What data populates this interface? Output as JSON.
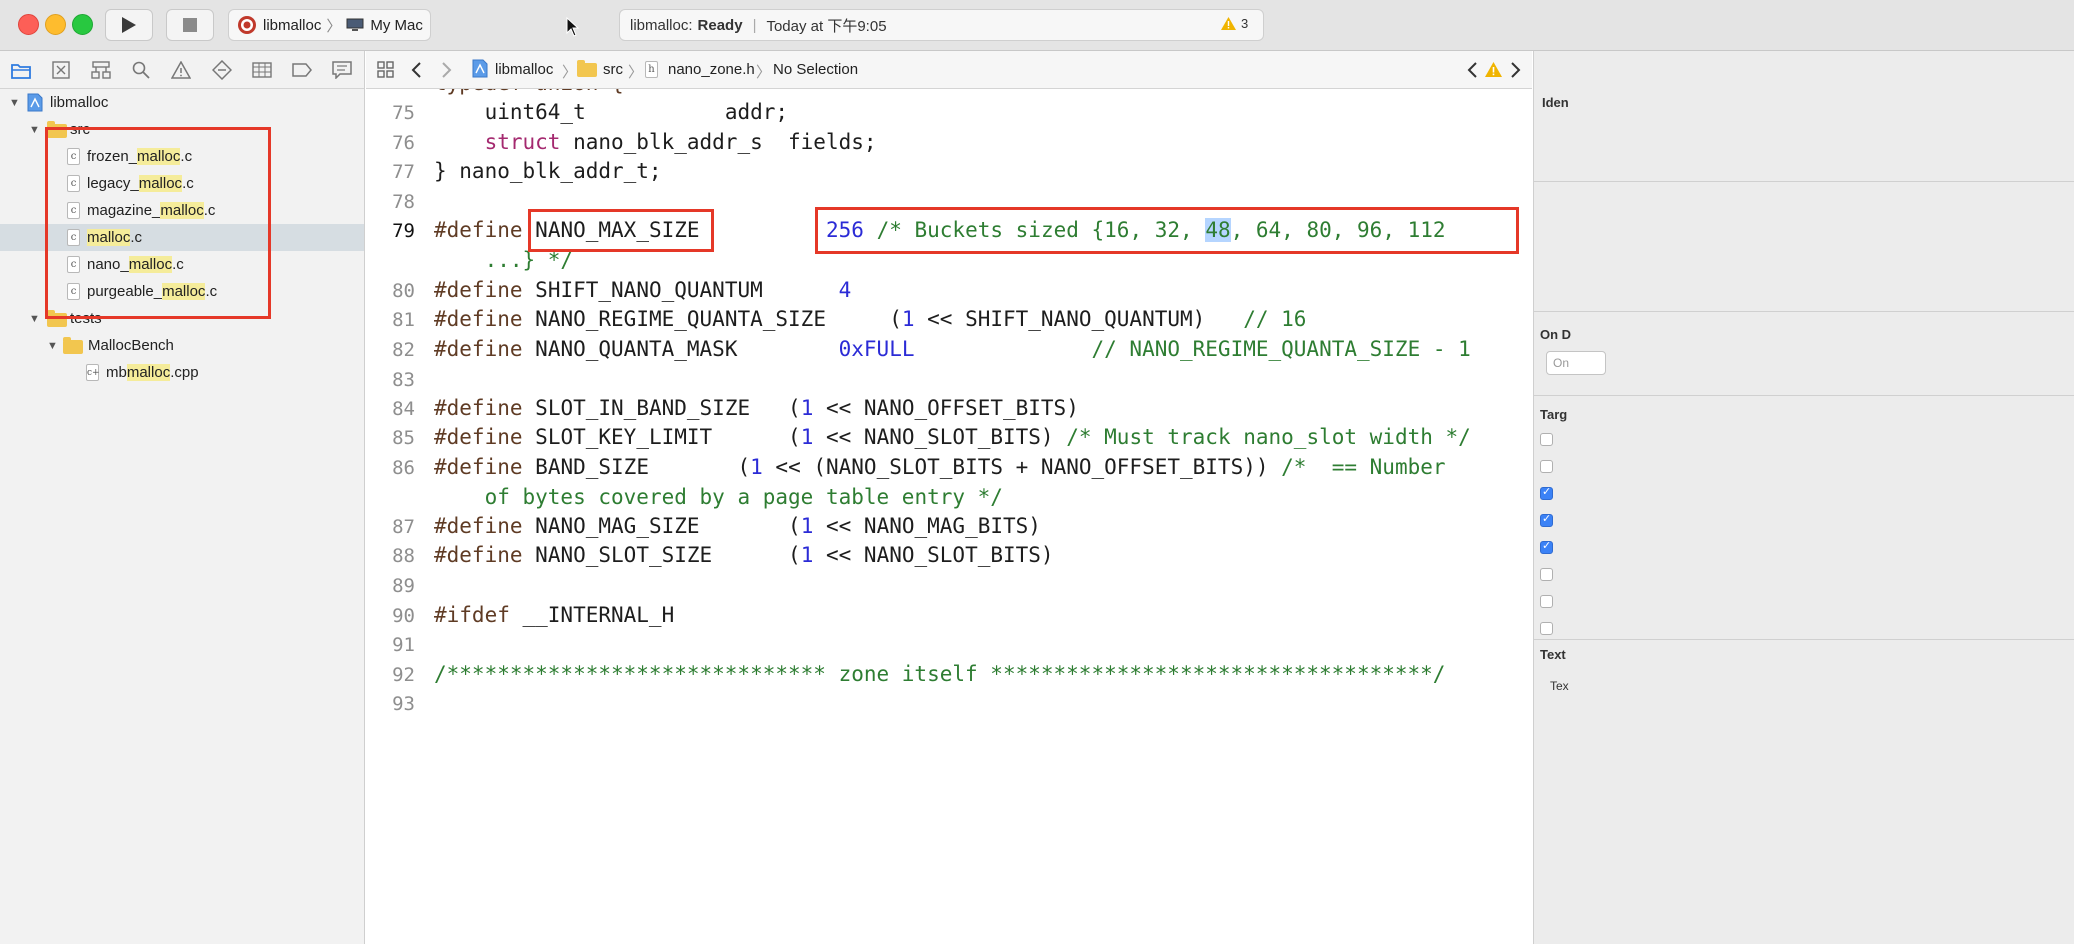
{
  "toolbar": {
    "run_icon": "play-icon",
    "stop_icon": "stop-icon",
    "scheme_name": "libmalloc",
    "destination": "My Mac",
    "status_project": "libmalloc:",
    "status_state": "Ready",
    "status_time": "Today at 下午9:05",
    "warning_count": "3"
  },
  "navigator": {
    "tabs": [
      "folder-icon",
      "source-control-icon",
      "symbol-icon",
      "find-icon",
      "issue-icon",
      "test-icon",
      "debug-icon",
      "breakpoint-icon",
      "report-icon"
    ],
    "project": "libmalloc",
    "group_src": "src",
    "files_src": [
      {
        "prefix": "frozen_",
        "match": "malloc",
        "suffix": ".c"
      },
      {
        "prefix": "legacy_",
        "match": "malloc",
        "suffix": ".c"
      },
      {
        "prefix": "magazine_",
        "match": "malloc",
        "suffix": ".c"
      },
      {
        "prefix": "",
        "match": "malloc",
        "suffix": ".c"
      },
      {
        "prefix": "nano_",
        "match": "malloc",
        "suffix": ".c"
      },
      {
        "prefix": "purgeable_",
        "match": "malloc",
        "suffix": ".c"
      }
    ],
    "group_tests": "tests",
    "group_bench": "MallocBench",
    "bench_file": {
      "prefix": "mb",
      "match": "malloc",
      "suffix": ".cpp"
    }
  },
  "jumpbar": {
    "project": "libmalloc",
    "folder": "src",
    "file": "nano_zone.h",
    "symbol": "No Selection"
  },
  "editor": {
    "line_numbers": [
      "75",
      "76",
      "77",
      "78",
      "79",
      "80",
      "81",
      "82",
      "83",
      "84",
      "85",
      "86",
      "87",
      "88",
      "89",
      "90",
      "91",
      "92",
      "93"
    ],
    "line75_type": "uint64_t",
    "line75_field": "addr;",
    "line76_kw": "struct",
    "line76_rest": " nano_blk_addr_s  fields;",
    "line77": "} nano_blk_addr_t;",
    "define_kw": "#define",
    "line79_name": "NANO_MAX_SIZE",
    "line79_value": "256",
    "line79_comment_a": "/* Buckets sized {16, 32, ",
    "line79_comment_sel": "48",
    "line79_comment_b": ", 64, 80, 96, 112",
    "line79_cont": "...} */",
    "line80_name": "SHIFT_NANO_QUANTUM",
    "line80_value": "4",
    "line81_name": "NANO_REGIME_QUANTA_SIZE",
    "line81_open": "(",
    "line81_num": "1",
    "line81_rest": " << SHIFT_NANO_QUANTUM)",
    "line81_comment": "// 16",
    "line82_name": "NANO_QUANTA_MASK",
    "line82_value": "0xFULL",
    "line82_comment": "// NANO_REGIME_QUANTA_SIZE - 1",
    "line84_name": "SLOT_IN_BAND_SIZE",
    "line84_num": "1",
    "line84_rest": " << NANO_OFFSET_BITS)",
    "line85_name": "SLOT_KEY_LIMIT",
    "line85_num": "1",
    "line85_rest": " << NANO_SLOT_BITS) ",
    "line85_comment": "/* Must track nano_slot width */",
    "line86_name": "BAND_SIZE",
    "line86_num": "1",
    "line86_rest": " << (NANO_SLOT_BITS + NANO_OFFSET_BITS)) ",
    "line86_comment": "/*  == Number",
    "line86_cont": "of bytes covered by a page table entry */",
    "line87_name": "NANO_MAG_SIZE",
    "line87_num": "1",
    "line87_rest": " << NANO_MAG_BITS)",
    "line88_name": "NANO_SLOT_SIZE",
    "line88_num": "1",
    "line88_rest": " << NANO_SLOT_BITS)",
    "line90_kw": "#ifdef",
    "line90_rest": " __INTERNAL_H",
    "line92_comment": "/****************************** zone itself ***********************************/"
  },
  "inspector": {
    "identity_label": "Iden",
    "on_demand_label": "On D",
    "on_demand_placeholder": "On",
    "target_label": "Targ",
    "text_label": "Text",
    "text_sub": "Tex",
    "target_checks": [
      false,
      false,
      true,
      true,
      true,
      false,
      false,
      false
    ]
  },
  "colors": {
    "annotation_red": "#e53828",
    "keyword": "#a4296f",
    "comment": "#2e7d32",
    "number": "#2b2bd6",
    "file_highlight": "#f5ec9a"
  }
}
